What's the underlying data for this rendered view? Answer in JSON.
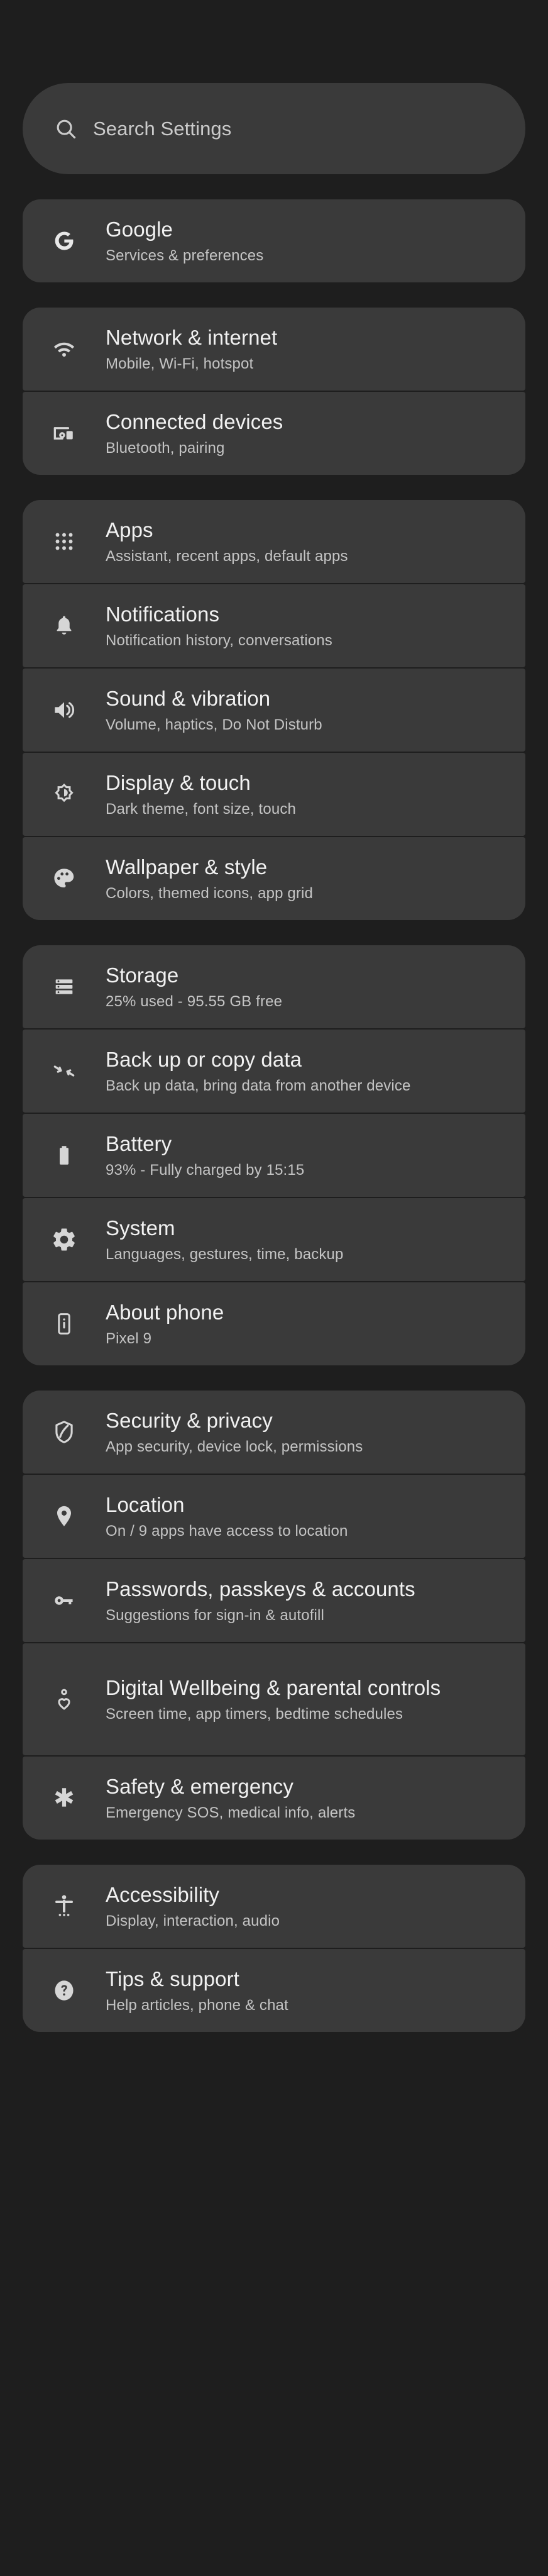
{
  "search": {
    "placeholder": "Search Settings",
    "icon": "search-icon"
  },
  "colors": {
    "page_background": "#1e1e1e",
    "card_background": "#3a3a3a",
    "title_text": "#f1f1f1",
    "subtitle_text": "#c4c4c4"
  },
  "groups": [
    {
      "items": [
        {
          "title": "Google",
          "subtitle": "Services & preferences",
          "icon": "google-g-icon"
        }
      ]
    },
    {
      "items": [
        {
          "title": "Network & internet",
          "subtitle": "Mobile, Wi-Fi, hotspot",
          "icon": "wifi-icon"
        },
        {
          "title": "Connected devices",
          "subtitle": "Bluetooth, pairing",
          "icon": "connected-devices-icon"
        }
      ]
    },
    {
      "items": [
        {
          "title": "Apps",
          "subtitle": "Assistant, recent apps, default apps",
          "icon": "app-grid-icon"
        },
        {
          "title": "Notifications",
          "subtitle": "Notification history, conversations",
          "icon": "bell-icon"
        },
        {
          "title": "Sound & vibration",
          "subtitle": "Volume, haptics, Do Not Disturb",
          "icon": "speaker-icon"
        },
        {
          "title": "Display & touch",
          "subtitle": "Dark theme, font size, touch",
          "icon": "brightness-icon"
        },
        {
          "title": "Wallpaper & style",
          "subtitle": "Colors, themed icons, app grid",
          "icon": "palette-icon"
        }
      ]
    },
    {
      "items": [
        {
          "title": "Storage",
          "subtitle": "25% used - 95.55 GB free",
          "icon": "storage-icon"
        },
        {
          "title": "Back up or copy data",
          "subtitle": "Back up data, bring data from another device",
          "icon": "transfer-arrows-icon"
        },
        {
          "title": "Battery",
          "subtitle": "93% - Fully charged by 15:15",
          "icon": "battery-icon"
        },
        {
          "title": "System",
          "subtitle": "Languages, gestures, time, backup",
          "icon": "gear-icon"
        },
        {
          "title": "About phone",
          "subtitle": "Pixel 9",
          "icon": "phone-info-icon"
        }
      ]
    },
    {
      "items": [
        {
          "title": "Security & privacy",
          "subtitle": "App security, device lock, permissions",
          "icon": "shield-icon"
        },
        {
          "title": "Location",
          "subtitle": "On / 9 apps have access to location",
          "icon": "location-pin-icon"
        },
        {
          "title": "Passwords, passkeys & accounts",
          "subtitle": "Suggestions for sign-in & autofill",
          "icon": "key-icon"
        },
        {
          "title": "Digital Wellbeing & parental controls",
          "subtitle": "Screen time, app timers, bedtime schedules",
          "icon": "wellbeing-icon",
          "tall": true
        },
        {
          "title": "Safety & emergency",
          "subtitle": "Emergency SOS, medical info, alerts",
          "icon": "emergency-star-icon"
        }
      ]
    },
    {
      "items": [
        {
          "title": "Accessibility",
          "subtitle": "Display, interaction, audio",
          "icon": "accessibility-icon"
        },
        {
          "title": "Tips & support",
          "subtitle": "Help articles, phone & chat",
          "icon": "help-circle-icon"
        }
      ]
    }
  ]
}
